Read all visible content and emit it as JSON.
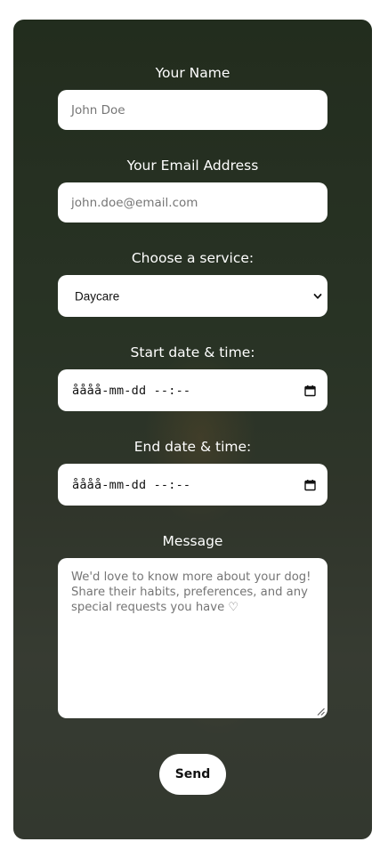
{
  "form": {
    "name": {
      "label": "Your Name",
      "placeholder": "John Doe"
    },
    "email": {
      "label": "Your Email Address",
      "placeholder": "john.doe@email.com"
    },
    "service": {
      "label": "Choose a service:",
      "selected": "Daycare"
    },
    "start": {
      "label": "Start date & time:",
      "value": "åååå-mm-dd --:--"
    },
    "end": {
      "label": "End date & time:",
      "value": "åååå-mm-dd --:--"
    },
    "message": {
      "label": "Message",
      "placeholder": "We'd love to know more about your dog! Share their habits, preferences, and any special requests you have ♡"
    },
    "submit_label": "Send"
  },
  "icons": {
    "select_arrow": "chevron-down-icon",
    "date_picker": "calendar-icon",
    "resize": "resize-handle-icon"
  }
}
